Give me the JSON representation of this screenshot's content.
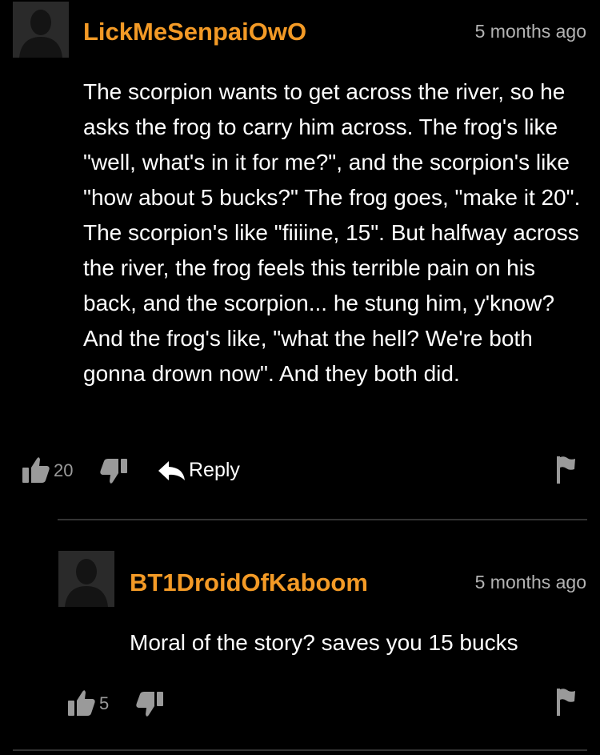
{
  "comments": [
    {
      "username": "LickMeSenpaiOwO",
      "time": "5 months ago",
      "text": "The scorpion wants to get across the river, so he asks the frog to carry him across. The frog's like \"well, what's in it for me?\", and the scorpion's like \"how about 5 bucks?\" The frog goes, \"make it 20\". The scorpion's like \"fiiiine, 15\". But halfway across the river, the frog feels this terrible pain on his back, and the scorpion... he stung him, y'know? And the frog's like, \"what the hell? We're both gonna drown now\". And they both did.",
      "likes": "20",
      "reply_label": "Reply"
    },
    {
      "username": "BT1DroidOfKaboom",
      "time": "5 months ago",
      "text": "Moral of the story? saves you 15 bucks",
      "likes": "5"
    }
  ],
  "colors": {
    "username": "#f39a26",
    "background": "#000000",
    "meta": "#b3b3b3"
  },
  "icons": [
    "avatar-silhouette",
    "thumbs-up-icon",
    "thumbs-down-icon",
    "reply-arrow-icon",
    "flag-icon"
  ]
}
